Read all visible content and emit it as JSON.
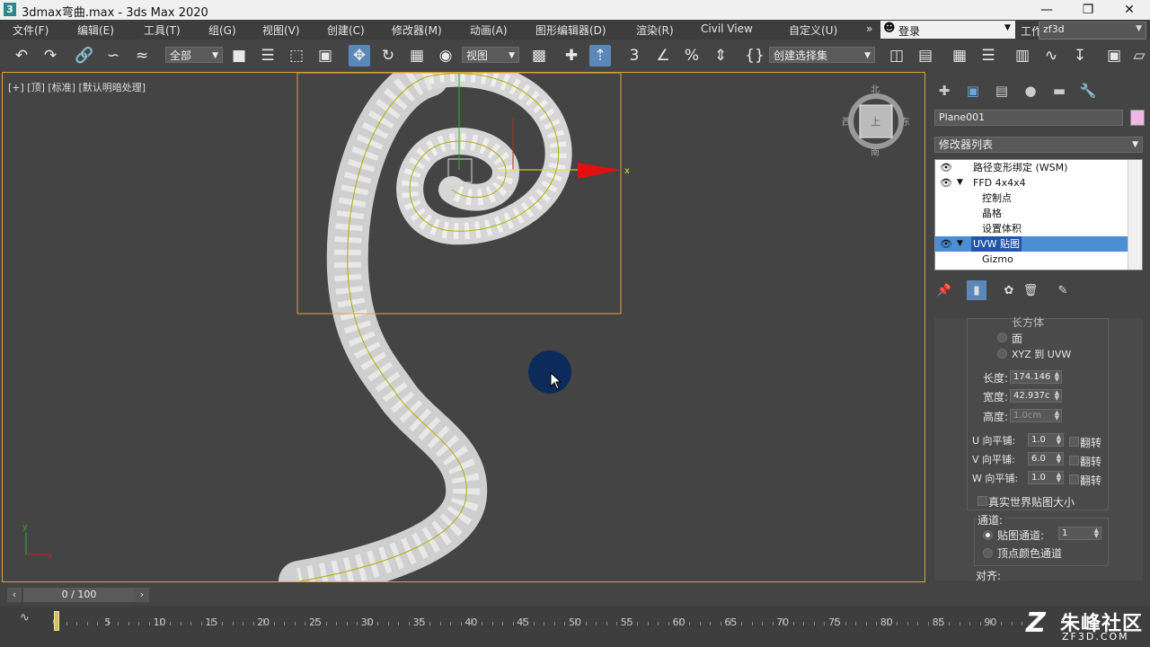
{
  "window": {
    "icon_glyph": "3",
    "title": "3dmax弯曲.max - 3ds Max 2020",
    "controls": [
      "minimize-icon",
      "restore-icon",
      "close-icon"
    ]
  },
  "menu": {
    "items": [
      "文件(F)",
      "编辑(E)",
      "工具(T)",
      "组(G)",
      "视图(V)",
      "创建(C)",
      "修改器(M)",
      "动画(A)",
      "图形编辑器(D)",
      "渲染(R)",
      "Civil View",
      "自定义(U)"
    ],
    "more": "»",
    "login": "登录",
    "workspace_label": "工作区:",
    "workspace_value": "zf3d"
  },
  "toolbar": {
    "selection_filter": "全部",
    "ref_coord": "视图",
    "named_selection": "创建选择集"
  },
  "viewport": {
    "label": "[+] [顶] [标准] [默认明暗处理]",
    "axis_x": "x",
    "viewcube_top": "北",
    "viewcube_left": "西",
    "viewcube_right": "东",
    "viewcube_bottom": "南",
    "viewcube_face": "上",
    "mini_axis_y": "y",
    "mini_axis_x": "x"
  },
  "command_panel": {
    "object_name": "Plane001",
    "object_color": "#f0b6e8",
    "modifier_list": "修改器列表",
    "stack": [
      {
        "label": "路径变形绑定 (WSM)",
        "eye": true,
        "level": 0
      },
      {
        "label": "FFD 4x4x4",
        "eye": true,
        "expand": true,
        "level": 0
      },
      {
        "label": "控制点",
        "level": 1
      },
      {
        "label": "晶格",
        "level": 1
      },
      {
        "label": "设置体积",
        "level": 1
      },
      {
        "label": "UVW 贴图",
        "eye": true,
        "expand": true,
        "level": 0,
        "selected": true
      },
      {
        "label": "Gizmo",
        "level": 1
      }
    ],
    "params": {
      "partial_top": "长方体",
      "face": "面",
      "xyz_uvw": "XYZ 到 UVW",
      "length_label": "长度:",
      "length_value": "174.146",
      "width_label": "宽度:",
      "width_value": "42.937c",
      "height_label": "高度:",
      "height_value": "1.0cm",
      "u_tile_label": "U 向平铺:",
      "u_tile_value": "1.0",
      "v_tile_label": "V 向平铺:",
      "v_tile_value": "6.0",
      "w_tile_label": "W 向平铺:",
      "w_tile_value": "1.0",
      "flip_label": "翻转",
      "real_world": "真实世界贴图大小",
      "channel_group": "通道:",
      "map_channel_label": "贴图通道:",
      "map_channel_value": "1",
      "vertex_color": "顶点颜色通道",
      "align_group": "对齐:"
    }
  },
  "timeline": {
    "frame_display": "0 / 100",
    "ticks": [
      "0",
      "5",
      "10",
      "15",
      "20",
      "25",
      "30",
      "35",
      "40",
      "45",
      "50",
      "55",
      "60",
      "65",
      "70",
      "75",
      "80",
      "85",
      "90"
    ]
  },
  "watermark": {
    "logo": "Z",
    "text": "朱峰社区",
    "sub": "ZF3D.COM"
  }
}
